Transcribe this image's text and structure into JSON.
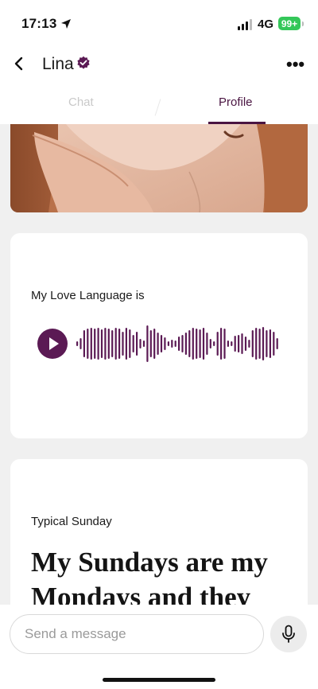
{
  "status_bar": {
    "time": "17:13",
    "network": "4G",
    "battery": "99+"
  },
  "header": {
    "name": "Lina",
    "verified_icon": "verified-badge-icon",
    "more_icon": "more-horizontal-icon",
    "more_glyph": "•••"
  },
  "tabs": [
    {
      "label": "Chat",
      "active": false
    },
    {
      "label": "Profile",
      "active": true
    }
  ],
  "voice_prompt": {
    "label": "My Love Language is",
    "play_icon": "play-icon"
  },
  "text_prompt": {
    "label": "Typical Sunday",
    "answer": "My Sundays are my Mondays and they"
  },
  "composer": {
    "placeholder": "Send a message",
    "mic_icon": "microphone-icon"
  },
  "colors": {
    "accent": "#5b1a54",
    "tab_active": "#4a1542",
    "battery": "#34c759",
    "background": "#f0f0f0"
  }
}
